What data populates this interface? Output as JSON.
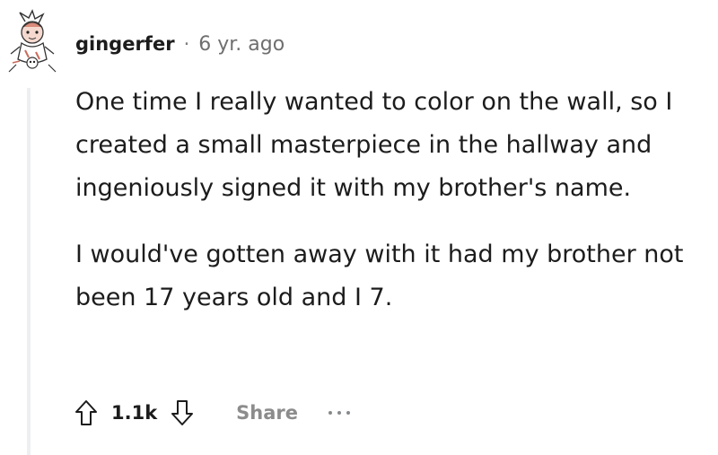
{
  "comment": {
    "username": "gingerfer",
    "separator": "·",
    "timestamp": "6 yr. ago",
    "paragraphs": [
      "One time I really wanted to color on the wall, so I created a small masterpiece in the hallway and ingeniously signed it with my brother's name.",
      "I would've gotten away with it had my brother not been 17 years old and I 7."
    ]
  },
  "actions": {
    "score": "1.1k",
    "share_label": "Share",
    "upvote_icon": "arrow-up-outline-icon",
    "downvote_icon": "arrow-down-outline-icon",
    "more_icon": "ellipsis-icon"
  },
  "colors": {
    "text": "#1c1c1c",
    "muted": "#8c8c8c",
    "thread_line": "#edeff1"
  }
}
